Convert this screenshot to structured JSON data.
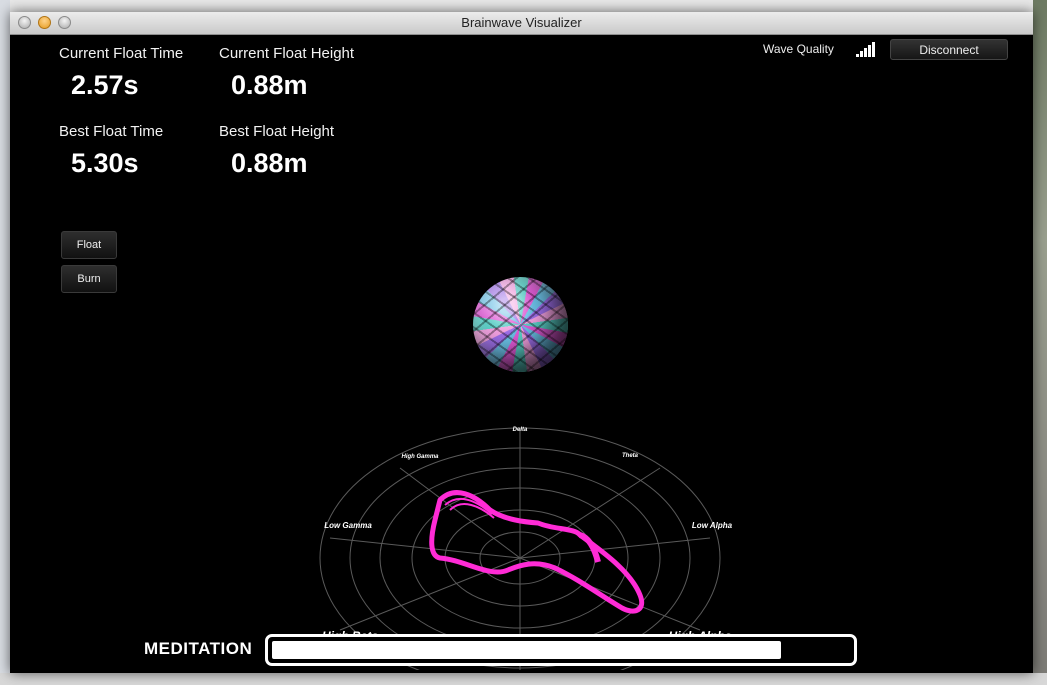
{
  "window": {
    "title": "Brainwave Visualizer"
  },
  "stats": {
    "current_float_time": {
      "label": "Current Float Time",
      "value": "2.57s"
    },
    "current_float_height": {
      "label": "Current Float Height",
      "value": "0.88m"
    },
    "best_float_time": {
      "label": "Best Float Time",
      "value": "5.30s"
    },
    "best_float_height": {
      "label": "Best Float Height",
      "value": "0.88m"
    }
  },
  "buttons": {
    "float": "Float",
    "burn": "Burn",
    "disconnect": "Disconnect"
  },
  "wave_quality": {
    "label": "Wave Quality",
    "bars": 5,
    "icon": "signal-strength-icon"
  },
  "radar": {
    "axes": [
      "Delta",
      "Theta",
      "Low Alpha",
      "High Alpha",
      "High Beta",
      "Low Gamma",
      "High Gamma"
    ],
    "accent": "#ff2bd6"
  },
  "meditation": {
    "label": "MEDITATION",
    "level": 0.88
  },
  "colors": {
    "background": "#000000",
    "accent": "#ff2bd6",
    "text": "#ffffff"
  }
}
